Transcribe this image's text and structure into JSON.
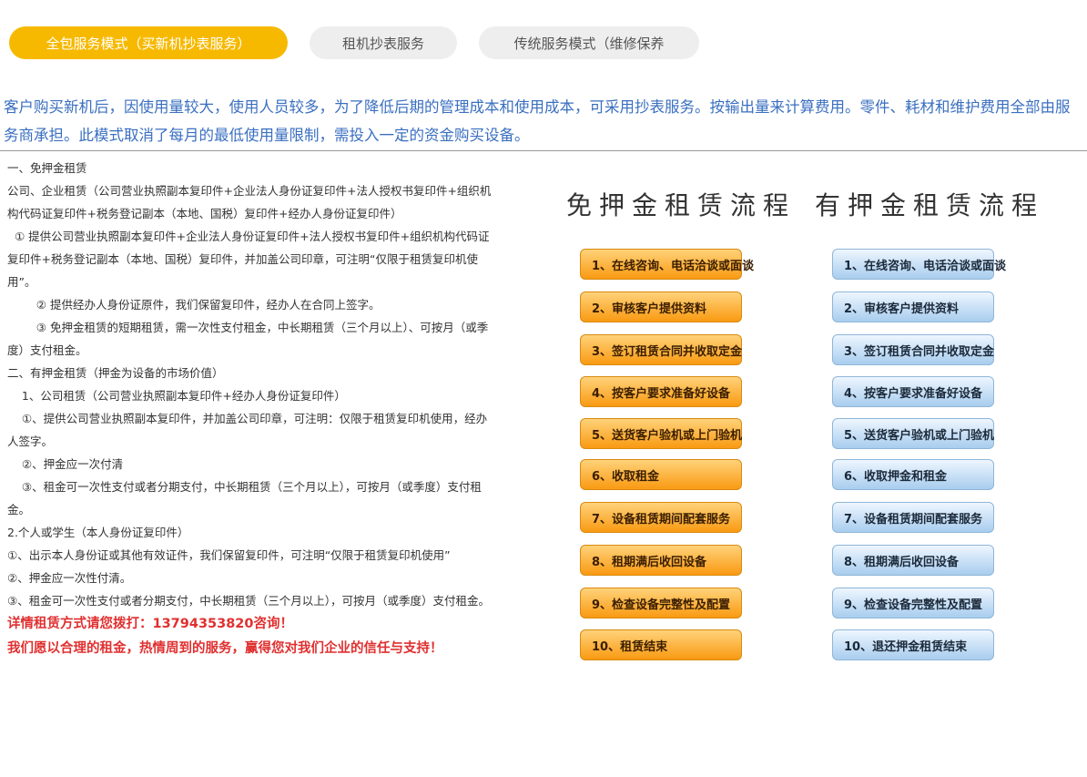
{
  "tabs": [
    {
      "label": "全包服务模式（买新机抄表服务）",
      "active": true
    },
    {
      "label": "租机抄表服务",
      "active": false
    },
    {
      "label": "传统服务模式（维修保养",
      "active": false
    }
  ],
  "intro": "客户购买新机后，因使用量较大，使用人员较多，为了降低后期的管理成本和使用成本，可采用抄表服务。按输出量来计算费用。零件、耗材和维护费用全部由服务商承担。此模式取消了每月的最低使用量限制，需投入一定的资金购买设备。",
  "details": [
    "一、免押金租赁",
    "公司、企业租赁（公司营业执照副本复印件+企业法人身份证复印件+法人授权书复印件+组织机构代码证复印件+税务登记副本（本地、国税）复印件+经办人身份证复印件）",
    "  ① 提供公司营业执照副本复印件+企业法人身份证复印件+法人授权书复印件+组织机构代码证复印件+税务登记副本（本地、国税）复印件，并加盖公司印章，可注明“仅限于租赁复印机使用”。",
    "        ② 提供经办人身份证原件，我们保留复印件，经办人在合同上签字。",
    "        ③ 免押金租赁的短期租赁，需一次性支付租金，中长期租赁（三个月以上）、可按月（或季度）支付租金。",
    "二、有押金租赁（押金为设备的市场价值）",
    "    1、公司租赁（公司营业执照副本复印件+经办人身份证复印件）",
    "    ①、提供公司营业执照副本复印件，并加盖公司印章，可注明：仅限于租赁复印机使用，经办人签字。",
    "    ②、押金应一次付清",
    "    ③、租金可一次性支付或者分期支付，中长期租赁（三个月以上），可按月（或季度）支付租金。",
    "2.个人或学生（本人身份证复印件）",
    "①、出示本人身份证或其他有效证件，我们保留复印件，可注明“仅限于租赁复印机使用”",
    "②、押金应一次性付清。",
    "③、租金可一次性支付或者分期支付，中长期租赁（三个月以上），可按月（或季度）支付租金。"
  ],
  "contact": {
    "line1": "详情租赁方式请您拨打：13794353820咨询！",
    "line2": "我们愿以合理的租金，热情周到的服务，赢得您对我们企业的信任与支持！"
  },
  "flow_no_deposit": {
    "title": "免押金租赁流程",
    "steps": [
      "1、在线咨询、电话洽谈或面谈",
      "2、审核客户提供资料",
      "3、签订租赁合同并收取定金",
      "4、按客户要求准备好设备",
      "5、送货客户验机或上门验机",
      "6、收取租金",
      "7、设备租赁期间配套服务",
      "8、租期满后收回设备",
      "9、检查设备完整性及配置",
      "10、租赁结束"
    ]
  },
  "flow_deposit": {
    "title": "有押金租赁流程",
    "steps": [
      "1、在线咨询、电话洽谈或面谈",
      "2、审核客户提供资料",
      "3、签订租赁合同并收取定金",
      "4、按客户要求准备好设备",
      "5、送货客户验机或上门验机",
      "6、收取押金和租金",
      "7、设备租赁期间配套服务",
      "8、租期满后收回设备",
      "9、检查设备完整性及配置",
      "10、退还押金租赁结束"
    ]
  },
  "colors": {
    "accent": "#f7b900",
    "intro_text": "#3a6fc0",
    "contact_red": "#e03030"
  }
}
